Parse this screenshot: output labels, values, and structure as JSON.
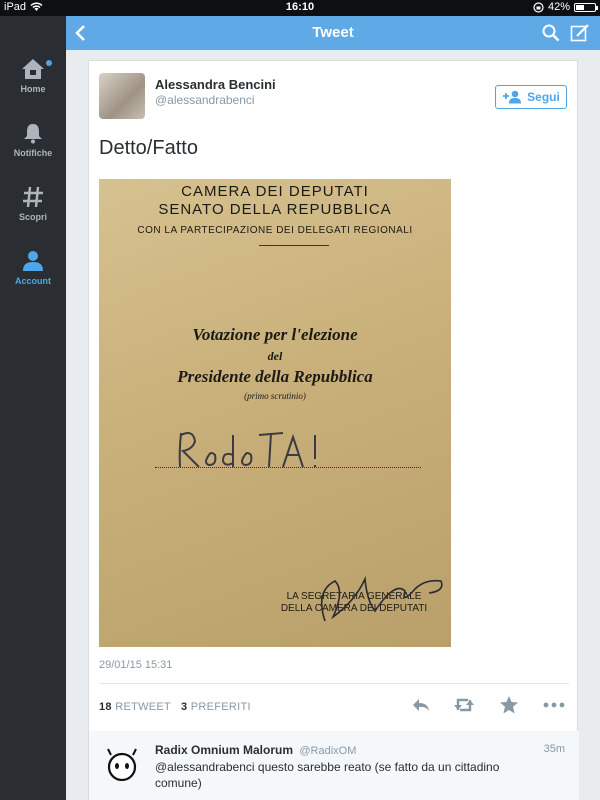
{
  "status_bar": {
    "device": "iPad",
    "time": "16:10",
    "battery": "42%",
    "battery_level": 0.42,
    "wifi_icon": "wifi-icon",
    "lock_icon": "rotation-lock-icon"
  },
  "sidebar": {
    "items": [
      {
        "label": "Home",
        "icon": "home-icon",
        "active": false,
        "has_dot": true
      },
      {
        "label": "Notifiche",
        "icon": "bell-icon",
        "active": false
      },
      {
        "label": "Scopri",
        "icon": "hashtag-icon",
        "active": false
      },
      {
        "label": "Account",
        "icon": "person-icon",
        "active": true
      }
    ]
  },
  "navbar": {
    "title": "Tweet",
    "back_icon": "chevron-left-icon",
    "search_icon": "search-icon",
    "compose_icon": "compose-icon"
  },
  "tweet": {
    "author_name": "Alessandra Bencini",
    "author_handle": "@alessandrabenci",
    "follow_label": "Segui",
    "text": "Detto/Fatto",
    "timestamp": "29/01/15 15:31",
    "retweets": "18",
    "retweets_label": "RETWEET",
    "favorites": "3",
    "favorites_label": "PREFERITI",
    "photo": {
      "line1": "CAMERA   DEI   DEPUTATI",
      "line2": "SENATO DELLA REPUBBLICA",
      "line3": "CON LA PARTECIPAZIONE DEI DELEGATI REGIONALI",
      "line4": "Votazione per l'elezione",
      "line5": "del",
      "line6": "Presidente della Repubblica",
      "line7": "(primo scrutinio)",
      "line8": "LA SEGRETARIA GENERALE",
      "line9": "DELLA CAMERA DEI DEPUTATI",
      "handwritten": "RodoTA!"
    }
  },
  "reply": {
    "name": "Radix Omnium Malorum",
    "handle": "@RadixOM",
    "time": "35m",
    "text": "@alessandrabenci questo sarebbe reato (se fatto da un cittadino comune)"
  },
  "colors": {
    "accent": "#4ea6e8",
    "navbar": "#5fa9e6",
    "sidebar": "#2a2e33"
  }
}
